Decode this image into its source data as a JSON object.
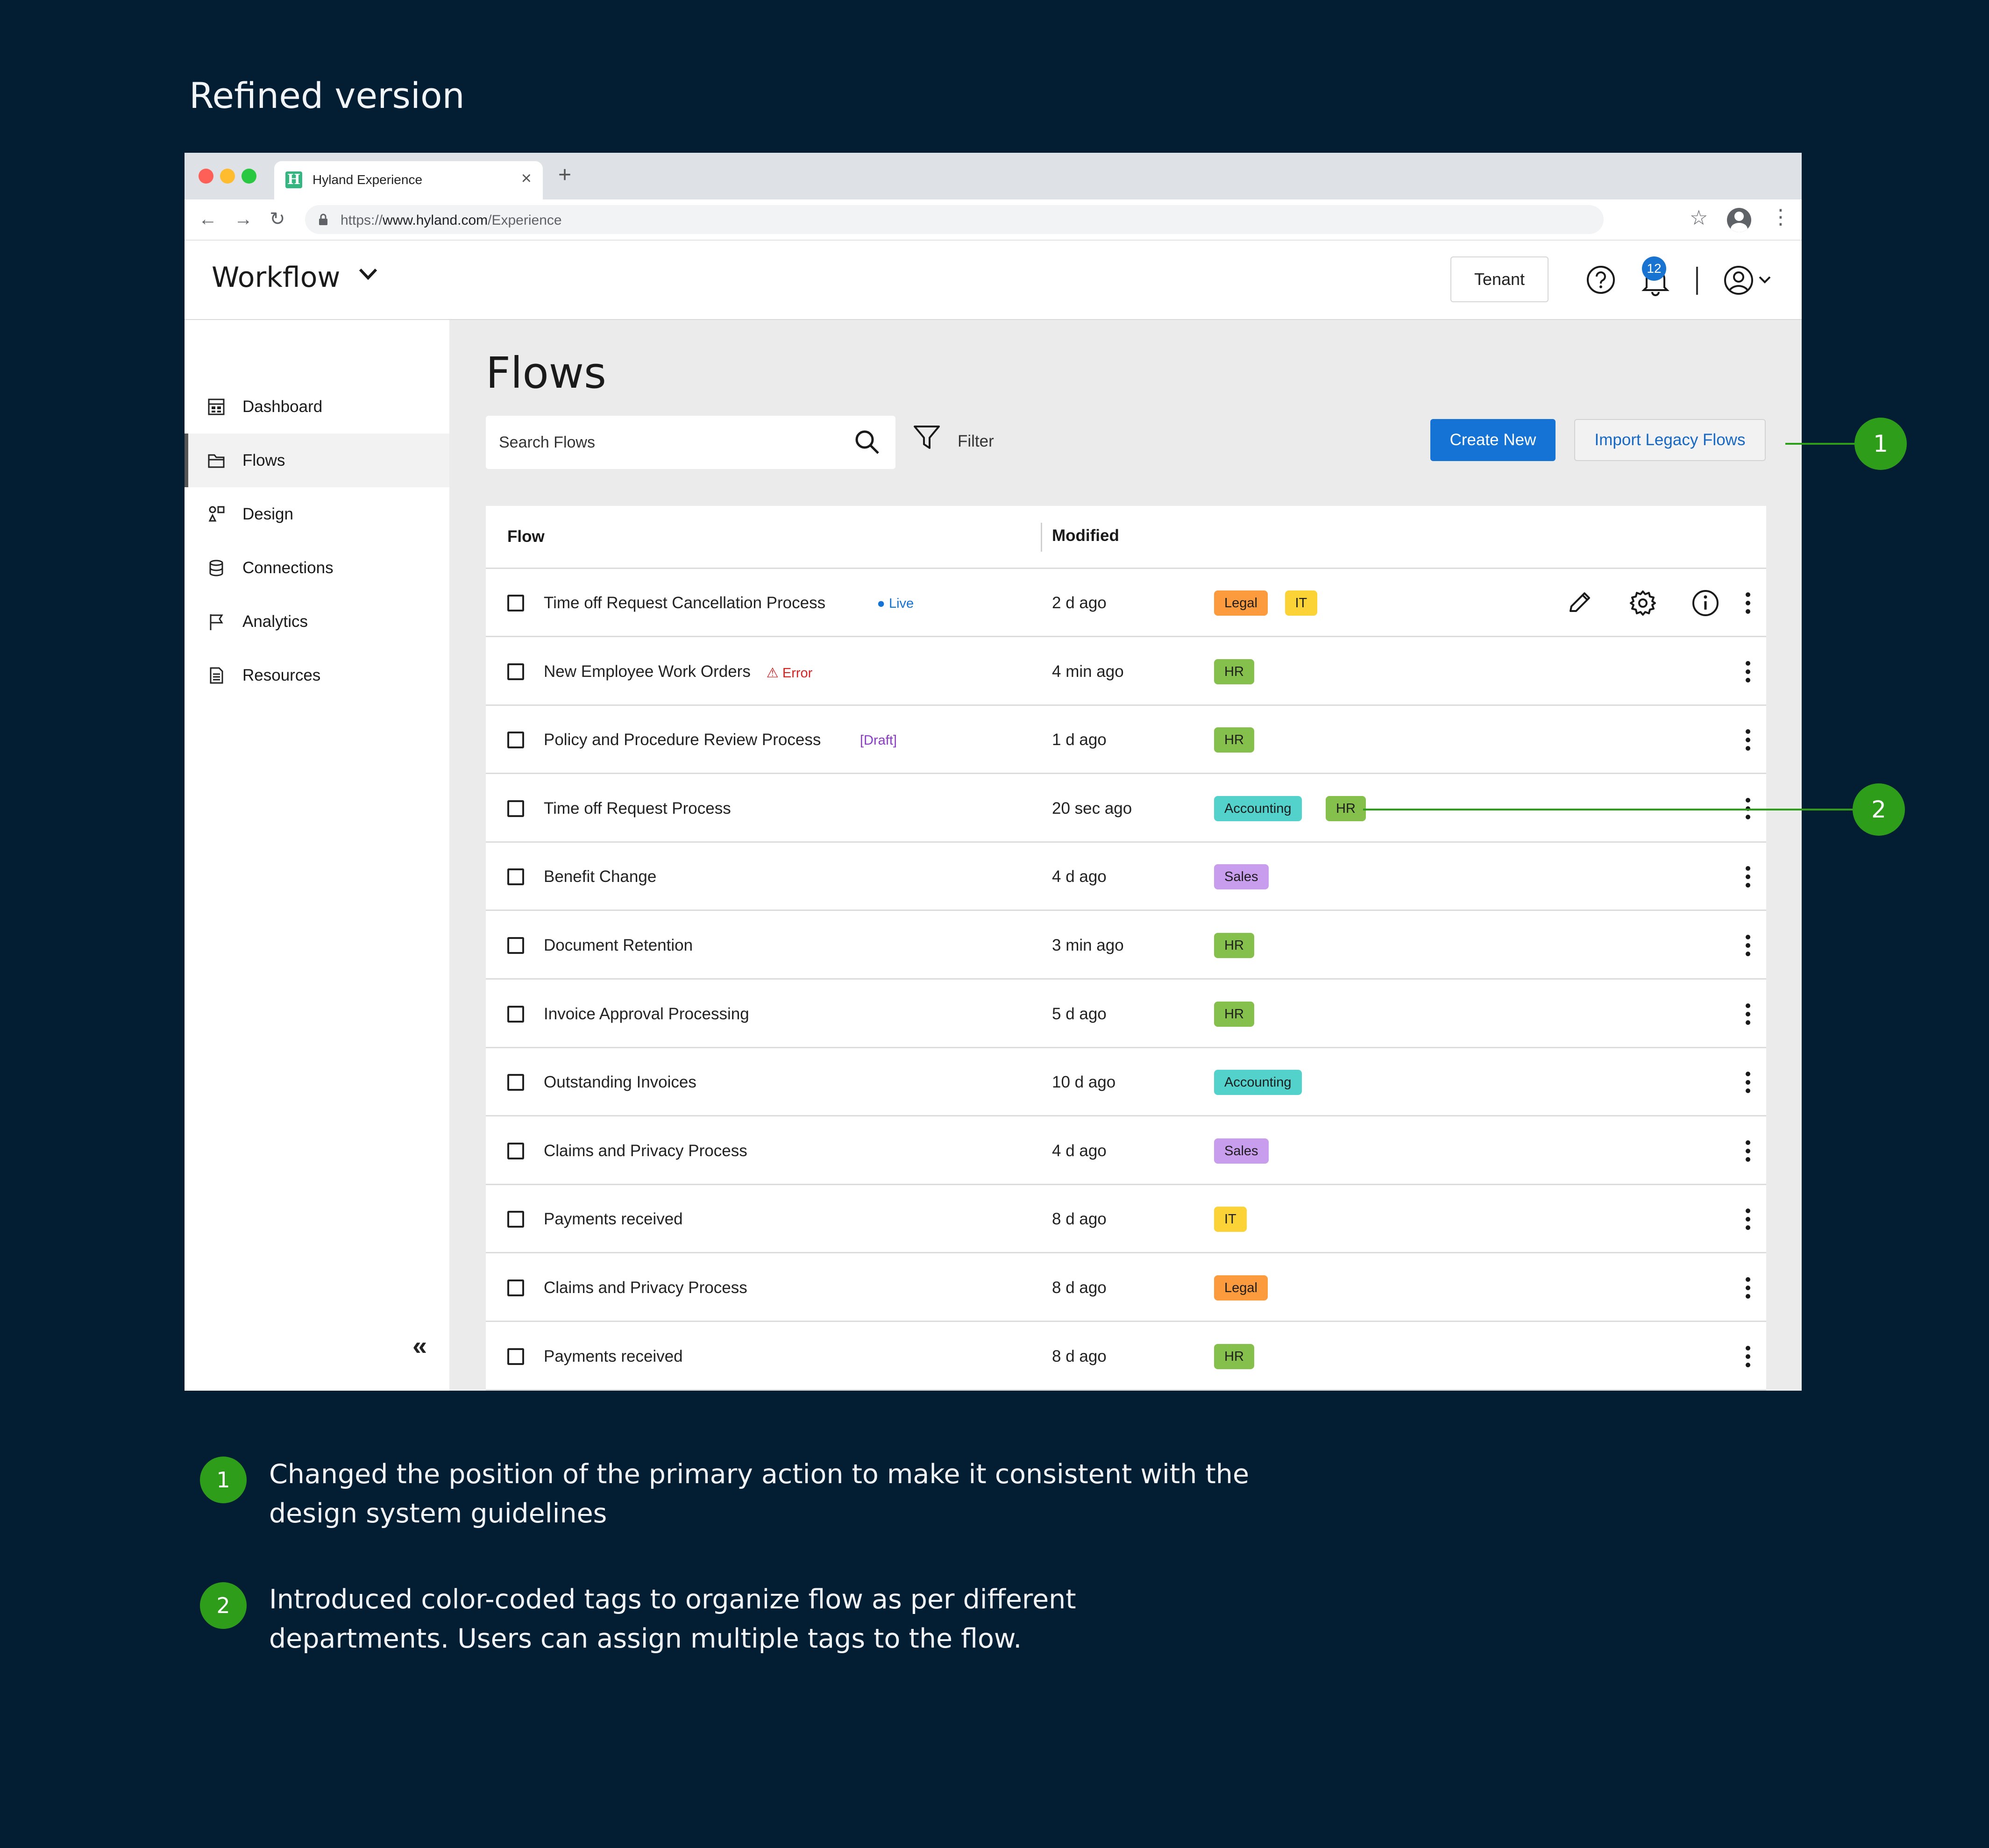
{
  "heading": "Refined version",
  "browser": {
    "tab_title": "Hyland Experience",
    "favicon_letter": "H",
    "url_prefix": "https://",
    "url_domain": "www.hyland.com",
    "url_path": "/Experience"
  },
  "app": {
    "title": "Workflow",
    "tenant_label": "Tenant",
    "notification_count": "12"
  },
  "sidebar": {
    "items": [
      {
        "label": "Dashboard",
        "icon": "dashboard-icon"
      },
      {
        "label": "Flows",
        "icon": "folder-icon",
        "active": true
      },
      {
        "label": "Design",
        "icon": "shapes-icon"
      },
      {
        "label": "Connections",
        "icon": "database-icon"
      },
      {
        "label": "Analytics",
        "icon": "flag-icon"
      },
      {
        "label": "Resources",
        "icon": "document-icon"
      }
    ],
    "collapse_glyph": "«"
  },
  "main": {
    "title": "Flows",
    "search_placeholder": "Search Flows",
    "filter_label": "Filter",
    "create_label": "Create New",
    "import_label": "Import Legacy Flows"
  },
  "table": {
    "columns": [
      "Flow",
      "Modified"
    ],
    "rows": [
      {
        "name": "Time off Request Cancellation Process",
        "status": "● Live",
        "status_type": "live",
        "modified": "2 d ago",
        "tags": [
          "Legal",
          "IT"
        ]
      },
      {
        "name": "New Employee Work Orders",
        "status": "⚠ Error",
        "status_type": "error",
        "modified": "4 min ago",
        "tags": [
          "HR"
        ]
      },
      {
        "name": "Policy and Procedure Review Process",
        "status": "[Draft]",
        "status_type": "draft",
        "modified": "1 d ago",
        "tags": [
          "HR"
        ]
      },
      {
        "name": "Time off Request Process",
        "status": "",
        "status_type": "",
        "modified": "20 sec ago",
        "tags": [
          "Accounting",
          "HR"
        ]
      },
      {
        "name": "Benefit Change",
        "status": "",
        "status_type": "",
        "modified": "4 d ago",
        "tags": [
          "Sales"
        ]
      },
      {
        "name": "Document Retention",
        "status": "",
        "status_type": "",
        "modified": "3 min ago",
        "tags": [
          "HR"
        ]
      },
      {
        "name": "Invoice Approval Processing",
        "status": "",
        "status_type": "",
        "modified": "5 d ago",
        "tags": [
          "HR"
        ]
      },
      {
        "name": "Outstanding Invoices",
        "status": "",
        "status_type": "",
        "modified": "10 d ago",
        "tags": [
          "Accounting"
        ]
      },
      {
        "name": "Claims and Privacy Process",
        "status": "",
        "status_type": "",
        "modified": "4 d ago",
        "tags": [
          "Sales"
        ]
      },
      {
        "name": "Payments received",
        "status": "",
        "status_type": "",
        "modified": "8 d ago",
        "tags": [
          "IT"
        ]
      },
      {
        "name": "Claims and Privacy Process",
        "status": "",
        "status_type": "",
        "modified": "8 d ago",
        "tags": [
          "Legal"
        ]
      },
      {
        "name": "Payments received",
        "status": "",
        "status_type": "",
        "modified": "8 d ago",
        "tags": [
          "HR"
        ]
      }
    ],
    "tag_colors": {
      "Legal": "#fb9b3e",
      "IT": "#fcd337",
      "HR": "#84c04b",
      "Accounting": "#53d2cb",
      "Sales": "#c99dee"
    }
  },
  "annotations": {
    "marker_1": "1",
    "marker_2": "2",
    "note_1": "Changed the position of the primary action to make it consistent with the design system guidelines",
    "note_2": "Introduced color-coded tags to organize flow as per different departments. Users can assign multiple tags to the flow."
  },
  "colors": {
    "background": "#031d33",
    "accent_green": "#2e9e1a",
    "primary_blue": "#1473d4"
  }
}
